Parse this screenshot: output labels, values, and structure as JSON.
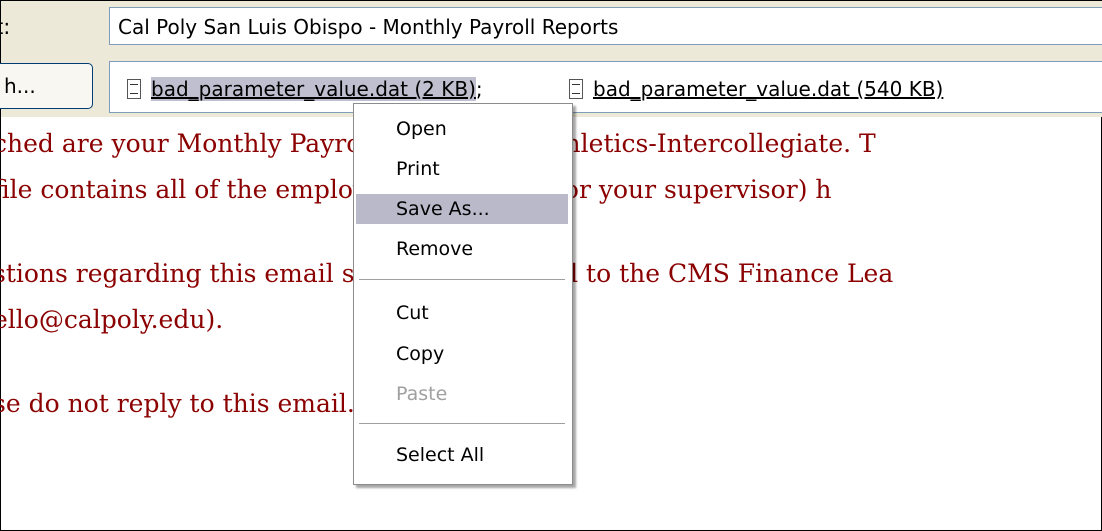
{
  "subject": {
    "label": "t:",
    "value": "Cal Poly San Luis Obispo - Monthly Payroll Reports"
  },
  "attach_button": {
    "label": "h..."
  },
  "attachments": [
    {
      "name": "bad_parameter_value.dat (2 KB)",
      "icon": "file-icon"
    },
    {
      "name": "bad_parameter_value.dat (540 KB)",
      "icon": "file-icon"
    }
  ],
  "attachment_separator": ";",
  "body_lines": [
    "ched are your Monthly Payroll Reports for Athletics-Intercollegiate.  T",
    "file contains all of the employees which you (or your supervisor) h",
    "stions regarding this email should be directed to the CMS Finance Lea",
    "ello@calpoly.edu).",
    "se do not reply to this email."
  ],
  "context_menu": {
    "items": [
      {
        "label": "Open",
        "state": "normal"
      },
      {
        "label": "Print",
        "state": "normal"
      },
      {
        "label": "Save As...",
        "state": "highlighted"
      },
      {
        "label": "Remove",
        "state": "normal"
      },
      {
        "label": "Cut",
        "state": "normal"
      },
      {
        "label": "Copy",
        "state": "normal"
      },
      {
        "label": "Paste",
        "state": "disabled"
      },
      {
        "label": "Select All",
        "state": "normal"
      }
    ]
  },
  "colors": {
    "body_text": "#8b0000",
    "highlight": "#b9b9c9",
    "chrome": "#ece9d8"
  }
}
